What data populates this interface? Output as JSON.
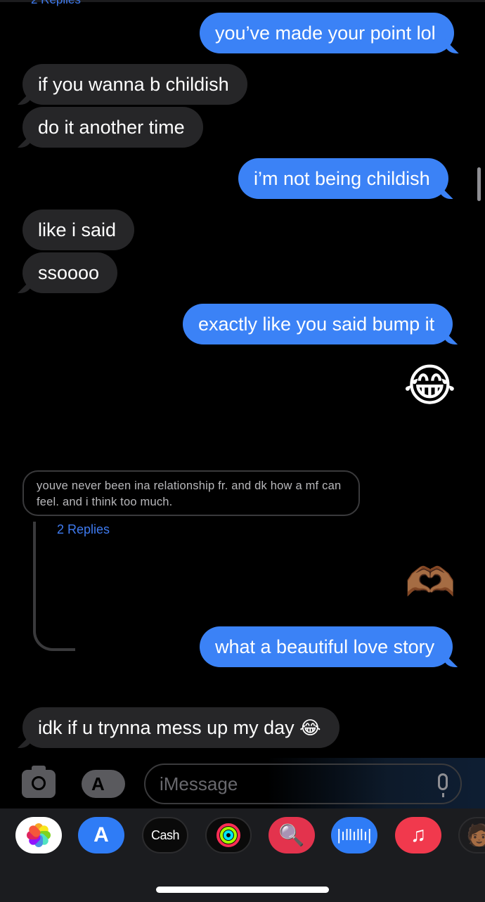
{
  "thread": {
    "top_replies_label": "2 Replies",
    "messages": [
      {
        "side": "sent",
        "text": "you’ve made your point lol"
      },
      {
        "side": "received",
        "text": "if you wanna b childish"
      },
      {
        "side": "received",
        "text": "do it another time"
      },
      {
        "side": "sent",
        "text": "i’m not being childish"
      },
      {
        "side": "received",
        "text": "like i said"
      },
      {
        "side": "received",
        "text": "ssoooo"
      },
      {
        "side": "sent",
        "text": "exactly like you said bump it"
      },
      {
        "side": "sent",
        "emoji": "😂"
      },
      {
        "side": "sent",
        "emoji": "🫶🏾"
      },
      {
        "side": "sent",
        "text": "what a beautiful love story"
      },
      {
        "side": "received",
        "text": "idk if u trynna mess up my day",
        "emoji": "😂"
      }
    ],
    "quoted_reply": {
      "text": "youve never been ina relationship fr. and dk how a mf can feel. and i think too much.",
      "replies_label": "2 Replies"
    }
  },
  "compose": {
    "placeholder": "iMessage",
    "camera_icon": "camera-icon",
    "apps_icon": "app-store-icon",
    "mic_icon": "microphone-icon"
  },
  "app_drawer": {
    "apps": [
      {
        "name": "Photos",
        "icon": "photos-icon"
      },
      {
        "name": "App Store",
        "icon": "app-store-icon",
        "glyph": "A"
      },
      {
        "name": "Cash",
        "icon": "cash-app-icon",
        "label": "Cash"
      },
      {
        "name": "Fitness",
        "icon": "activity-rings-icon"
      },
      {
        "name": "Images",
        "icon": "image-search-icon",
        "glyph": "🔍"
      },
      {
        "name": "Audio Message",
        "icon": "audio-waveform-icon",
        "glyph": "|ıllıllı|"
      },
      {
        "name": "Music",
        "icon": "music-note-icon",
        "glyph": "♫"
      },
      {
        "name": "Memoji",
        "icon": "memoji-icon",
        "glyph": "🧑🏾"
      }
    ]
  },
  "colors": {
    "sent_bubble": "#3b82f6",
    "received_bubble": "#262628",
    "link": "#3f7bf0",
    "background": "#000000"
  }
}
